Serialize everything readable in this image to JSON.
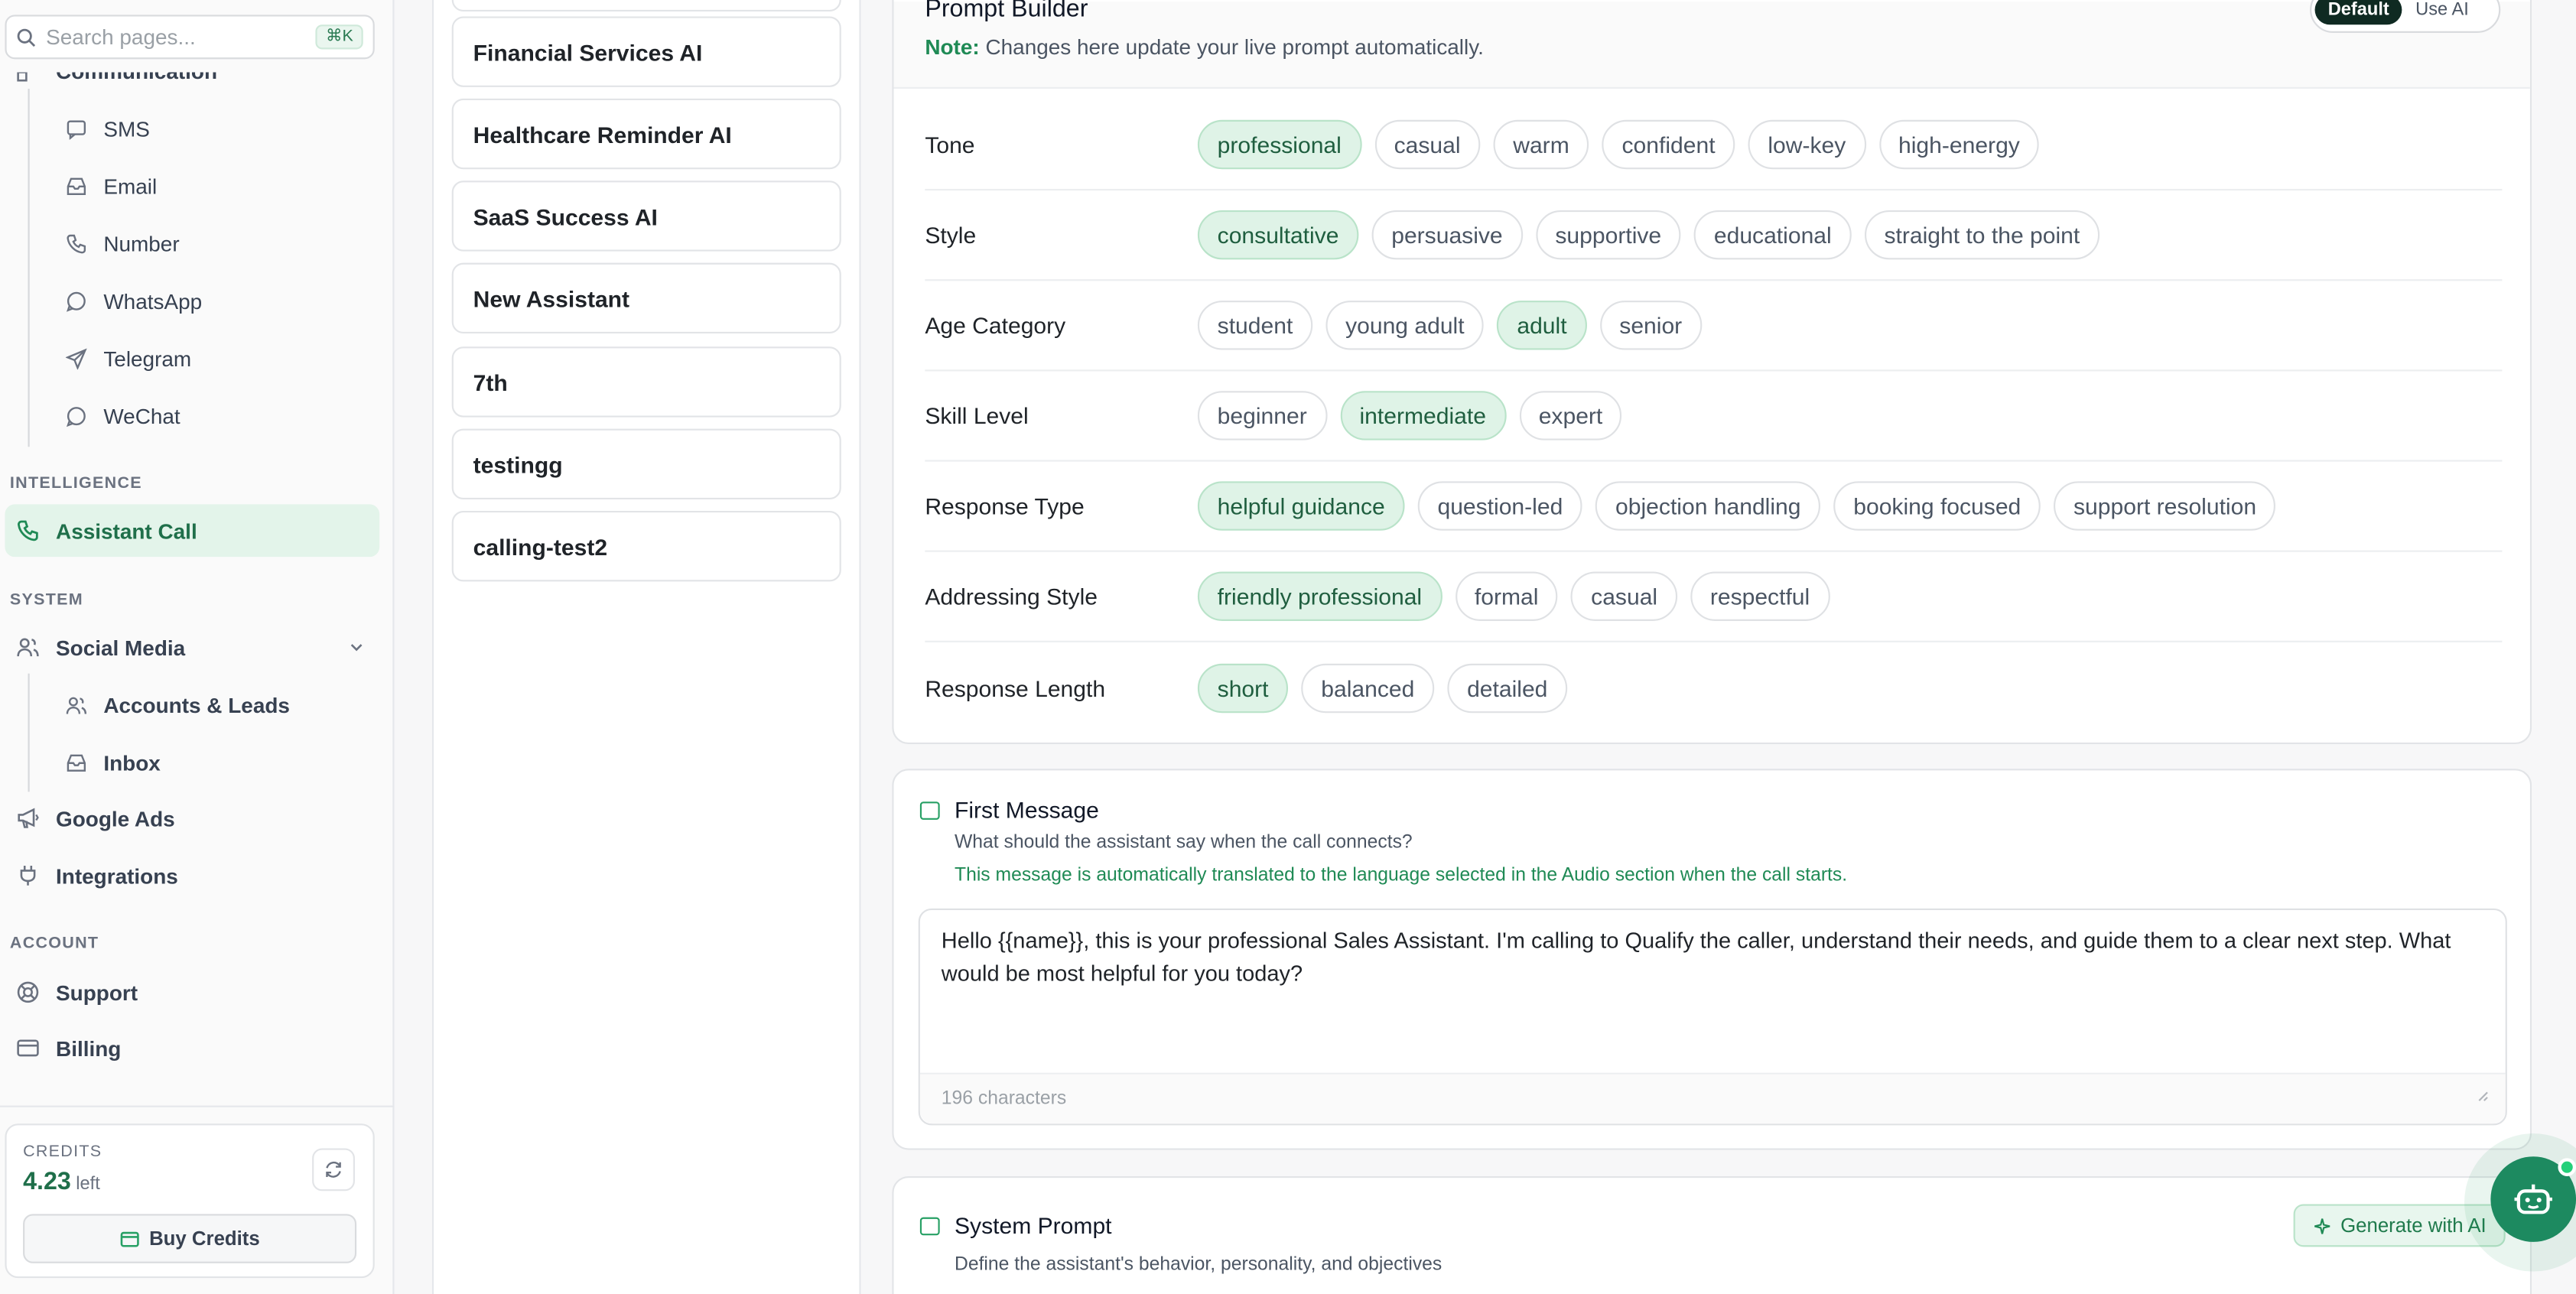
{
  "search": {
    "placeholder": "Search pages...",
    "shortcut": "⌘K"
  },
  "sidebar": {
    "partial_section": "Communication",
    "comm_items": [
      {
        "label": "SMS",
        "icon": "chat-icon"
      },
      {
        "label": "Email",
        "icon": "inbox-icon"
      },
      {
        "label": "Number",
        "icon": "phone-icon"
      },
      {
        "label": "WhatsApp",
        "icon": "chat-icon"
      },
      {
        "label": "Telegram",
        "icon": "send-icon"
      },
      {
        "label": "WeChat",
        "icon": "chat-icon"
      }
    ],
    "sections": {
      "intelligence": "INTELLIGENCE",
      "system": "SYSTEM",
      "account": "ACCOUNT"
    },
    "assistant_call": "Assistant Call",
    "social_media": "Social Media",
    "social_items": [
      {
        "label": "Accounts & Leads",
        "icon": "users-icon"
      },
      {
        "label": "Inbox",
        "icon": "inbox-icon"
      }
    ],
    "google_ads": "Google Ads",
    "integrations": "Integrations",
    "support": "Support",
    "billing": "Billing",
    "credits": {
      "label": "CREDITS",
      "value": "4.23",
      "suffix": "left",
      "buy": "Buy Credits"
    }
  },
  "assistants": [
    "Financial Services AI",
    "Healthcare Reminder AI",
    "SaaS Success AI",
    "New Assistant",
    "7th",
    "testingg",
    "calling-test2"
  ],
  "prompt_builder": {
    "title": "Prompt Builder",
    "note_label": "Note:",
    "note_text": "Changes here update your live prompt automatically.",
    "mode_default": "Default",
    "mode_ai": "Use AI",
    "rows": [
      {
        "label": "Tone",
        "options": [
          "professional",
          "casual",
          "warm",
          "confident",
          "low-key",
          "high-energy"
        ],
        "selected": "professional"
      },
      {
        "label": "Style",
        "options": [
          "consultative",
          "persuasive",
          "supportive",
          "educational",
          "straight to the point"
        ],
        "selected": "consultative"
      },
      {
        "label": "Age Category",
        "options": [
          "student",
          "young adult",
          "adult",
          "senior"
        ],
        "selected": "adult"
      },
      {
        "label": "Skill Level",
        "options": [
          "beginner",
          "intermediate",
          "expert"
        ],
        "selected": "intermediate"
      },
      {
        "label": "Response Type",
        "options": [
          "helpful guidance",
          "question-led",
          "objection handling",
          "booking focused",
          "support resolution"
        ],
        "selected": "helpful guidance"
      },
      {
        "label": "Addressing Style",
        "options": [
          "friendly professional",
          "formal",
          "casual",
          "respectful"
        ],
        "selected": "friendly professional"
      },
      {
        "label": "Response Length",
        "options": [
          "short",
          "balanced",
          "detailed"
        ],
        "selected": "short"
      }
    ]
  },
  "first_message": {
    "title": "First Message",
    "subtitle": "What should the assistant say when the call connects?",
    "note": "This message is automatically translated to the language selected in the Audio section when the call starts.",
    "value": "Hello {{name}}, this is your professional Sales Assistant. I'm calling to Qualify the caller, understand their needs, and guide them to a clear next step. What would be most helpful for you today?",
    "count": "196 characters"
  },
  "system_prompt": {
    "title": "System Prompt",
    "subtitle": "Define the assistant's behavior, personality, and objectives",
    "generate": "Generate with AI"
  },
  "colors": {
    "accent": "#1f8a55",
    "selected_chip": "#dff3e7",
    "dark": "#0f2a22"
  }
}
